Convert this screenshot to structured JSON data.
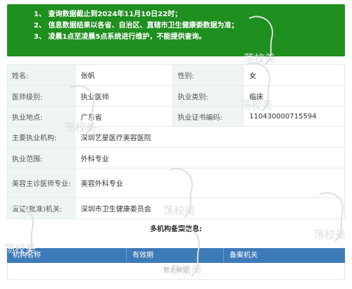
{
  "notice": {
    "line1": "1、 查询数据截止到2024年11月10日22时；",
    "line2": "2、 信息数据结果以各省、自治区、直辖市卫生健康委数据为准；",
    "line3": "3、 凌晨1点至凌晨5点系统进行维护，不能提供查询。"
  },
  "doctor": {
    "name_label": "姓名:",
    "name": "张帆",
    "gender_label": "性别:",
    "gender": "女",
    "level_label": "医师级别:",
    "level": "执业医师",
    "category_label": "执业类别:",
    "category": "临床",
    "location_label": "执业地点:",
    "location": "广东省",
    "cert_label": "执业证书编码:",
    "cert": "110430000715594",
    "institution_label": "主要执业机构:",
    "institution": "深圳艺星医疗美容医院",
    "scope_label": "执业范围:",
    "scope": "外科专业",
    "cosmetic_label": "美容主诊医师专业:",
    "cosmetic": "美容外科专业",
    "issuer_label": "发证(批准)机关:",
    "issuer": "深圳市卫生健康委员会"
  },
  "multi_org": {
    "title": "多机构备案信息:",
    "columns": [
      "机构名称",
      "有效期",
      "备案机关"
    ],
    "empty_text": "暂无数据"
  },
  "watermark": {
    "text": "荡校美",
    "color": "#d8dcdc"
  },
  "colors": {
    "notice_bg": "#1f8f1f",
    "label_bg": "#eff5f2",
    "table_header": "#3d7ab8"
  }
}
